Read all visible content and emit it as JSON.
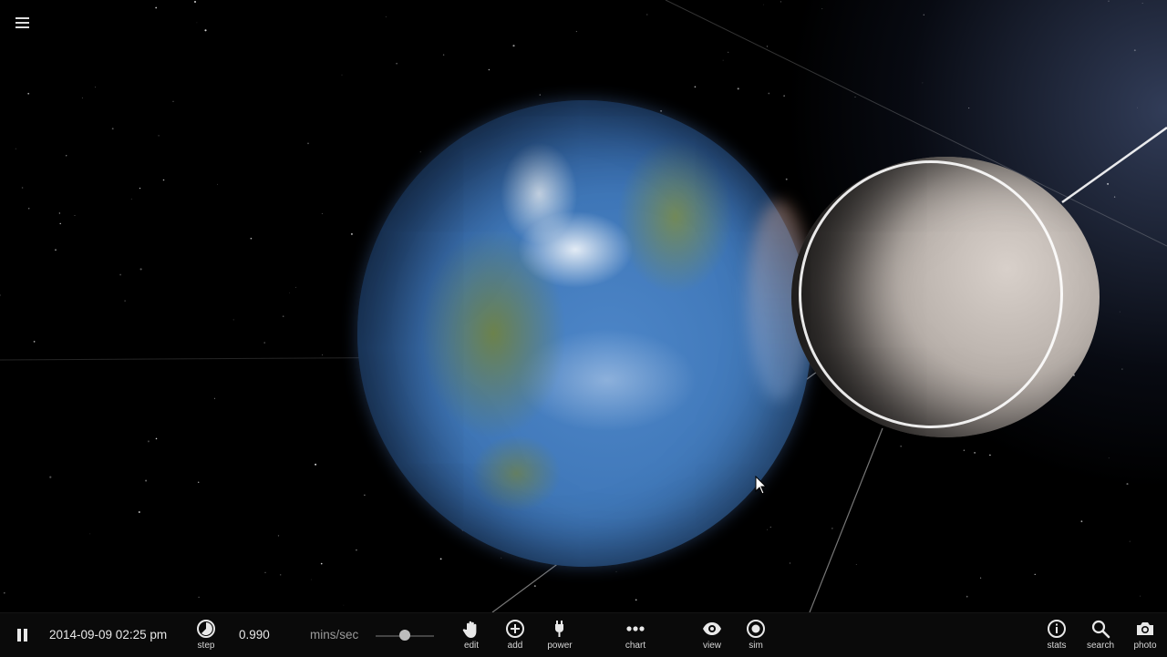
{
  "app": {
    "menu_icon": "hamburger-menu-icon"
  },
  "toolbar": {
    "datetime": "2014-09-09 02:25 pm",
    "speed_value": "0.990",
    "speed_unit": "mins/sec",
    "speed_slider_fraction": 0.5,
    "buttons": [
      {
        "id": "pause",
        "icon": "pause-icon",
        "label": ""
      },
      {
        "id": "step",
        "icon": "step-icon",
        "label": "step"
      },
      {
        "id": "edit",
        "icon": "hand-icon",
        "label": "edit"
      },
      {
        "id": "add",
        "icon": "add-circle-icon",
        "label": "add"
      },
      {
        "id": "power",
        "icon": "power-plug-icon",
        "label": "power"
      },
      {
        "id": "chart",
        "icon": "chart-dots-icon",
        "label": "chart"
      },
      {
        "id": "view",
        "icon": "eye-icon",
        "label": "view"
      },
      {
        "id": "sim",
        "icon": "sim-target-icon",
        "label": "sim"
      },
      {
        "id": "stats",
        "icon": "info-icon",
        "label": "stats"
      },
      {
        "id": "search",
        "icon": "search-icon",
        "label": "search"
      },
      {
        "id": "photo",
        "icon": "camera-icon",
        "label": "photo"
      }
    ]
  },
  "colors": {
    "toolbar_bg": "#0a0a0a",
    "text": "#e8e8e8",
    "muted_text": "#9a9a9a",
    "orbit_line": "#cfcfcf"
  }
}
